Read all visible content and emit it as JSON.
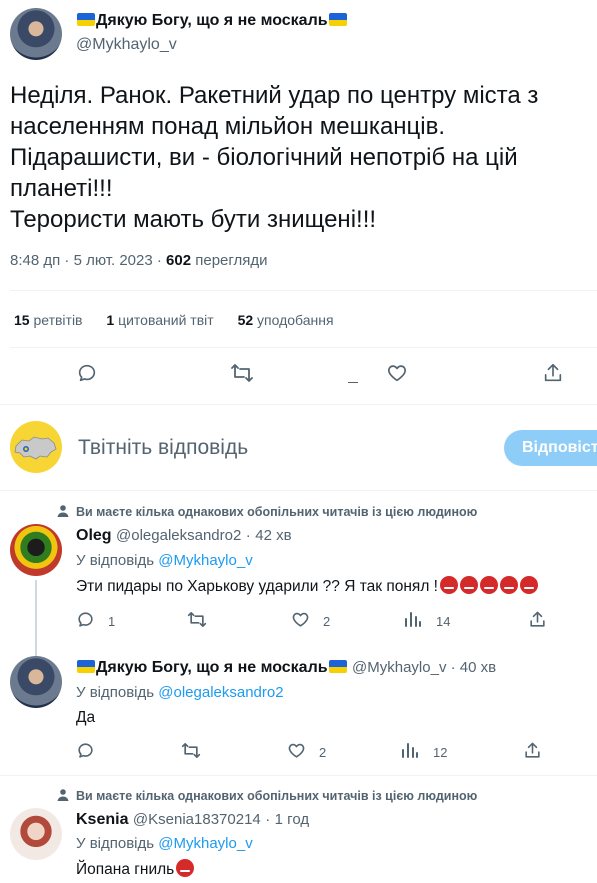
{
  "main_tweet": {
    "display_name": "Дякую Богу, що я не москаль",
    "handle": "@Mykhaylo_v",
    "text_lines": [
      "Неділя. Ранок. Ракетний удар по центру міста з",
      "населенням понад мільйон мешканців.",
      "Підарашисти, ви - біологічний непотріб на цій",
      "планеті!!!",
      "Терористи мають бути знищені!!!"
    ],
    "time": "8:48 дп",
    "date": "5 лют. 2023",
    "views_count": "602",
    "views_label": "перегляди",
    "retweets_count": "15",
    "retweets_label": "ретвітів",
    "quotes_count": "1",
    "quotes_label": "цитований твіт",
    "likes_count": "52",
    "likes_label": "уподобання"
  },
  "compose": {
    "placeholder": "Твітніть відповідь",
    "button_label": "Відповісти"
  },
  "replies": [
    {
      "mutual_note": "Ви маєте кілька однакових обопільних читачів із цією людиною",
      "display_name": "Oleg",
      "handle": "@olegaleksandro2",
      "time": "42 хв",
      "reply_to_label": "У відповідь",
      "reply_to_handle": "@Mykhaylo_v",
      "text": "Эти пидары по Харькову ударили ?? Я так понял !",
      "reply_count": "1",
      "retweet_count": "",
      "like_count": "2",
      "view_count": "14"
    },
    {
      "display_name": "Дякую Богу, що я не москаль",
      "handle": "@Mykhaylo_v",
      "time": "40 хв",
      "reply_to_label": "У відповідь",
      "reply_to_handle": "@olegaleksandro2",
      "text": "Да",
      "reply_count": "",
      "retweet_count": "",
      "like_count": "2",
      "view_count": "12"
    },
    {
      "mutual_note": "Ви маєте кілька однакових обопільних читачів із цією людиною",
      "display_name": "Ksenia",
      "handle": "@Ksenia18370214",
      "time": "1 год",
      "reply_to_label": "У відповідь",
      "reply_to_handle": "@Mykhaylo_v",
      "text": "Йопана гниль"
    }
  ]
}
